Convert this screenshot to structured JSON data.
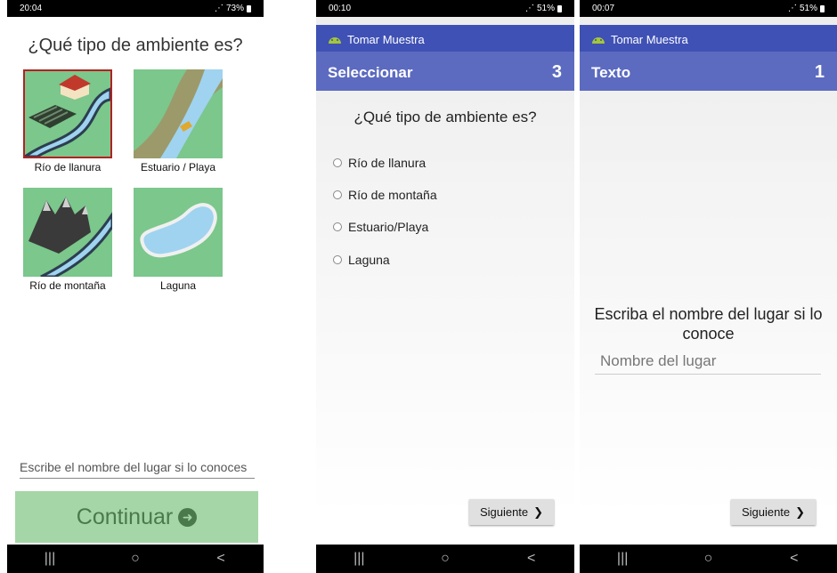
{
  "screen1": {
    "status": {
      "time": "20:04",
      "battery": "73%"
    },
    "title": "¿Qué tipo de ambiente es?",
    "tiles": [
      {
        "label": "Río de llanura",
        "selected": true
      },
      {
        "label": "Estuario / Playa",
        "selected": false
      },
      {
        "label": "Río de montaña",
        "selected": false
      },
      {
        "label": "Laguna",
        "selected": false
      }
    ],
    "place_placeholder": "Escribe el nombre del lugar si lo conoces",
    "continue_label": "Continuar"
  },
  "screen2": {
    "status": {
      "time": "00:10",
      "battery": "51%"
    },
    "app_title": "Tomar Muestra",
    "header_title": "Seleccionar",
    "header_number": "3",
    "question": "¿Qué tipo de ambiente es?",
    "options": [
      "Río de llanura",
      "Río de montaña",
      "Estuario/Playa",
      "Laguna"
    ],
    "next_label": "Siguiente"
  },
  "screen3": {
    "status": {
      "time": "00:07",
      "battery": "51%"
    },
    "app_title": "Tomar Muestra",
    "header_title": "Texto",
    "header_number": "1",
    "prompt": "Escriba el nombre del lugar si lo conoce",
    "place_placeholder": "Nombre del lugar",
    "next_label": "Siguiente"
  },
  "nav": {
    "recent": "|||",
    "home": "○",
    "back": "<"
  },
  "colors": {
    "appbar": "#3f51b5",
    "headerbar": "#5c6bc0",
    "tile_green": "#7bc78c",
    "continue_bg": "#a5d6a7",
    "selected_border": "#b22222"
  },
  "icons": [
    "wifi-signal-icon",
    "battery-icon",
    "circle-arrow-right-icon",
    "chevron-right-icon",
    "android-logo-icon"
  ]
}
